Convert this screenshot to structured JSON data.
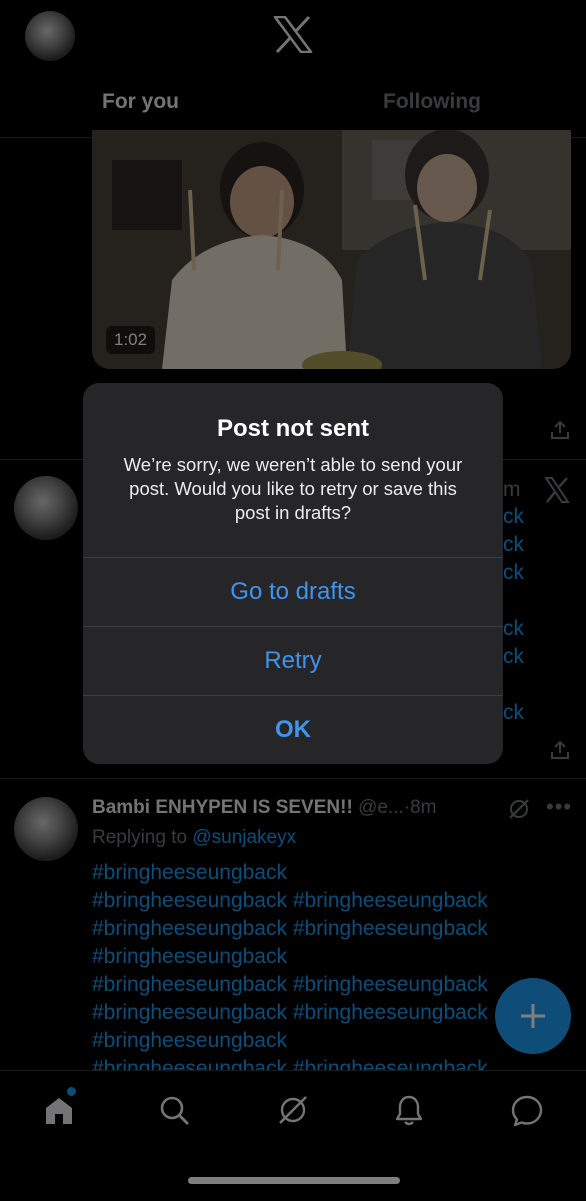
{
  "header": {
    "tabs": [
      {
        "label": "For you",
        "active": true
      },
      {
        "label": "Following",
        "active": false
      }
    ]
  },
  "feed": {
    "first_post": {
      "video_duration": "1:02"
    },
    "second_post": {
      "time_fragment": "m",
      "hashtag_fragments": [
        "ck",
        "ck",
        "ck",
        "ck",
        "ck",
        "ck"
      ]
    },
    "third_post": {
      "display_name": "Bambi ENHYPEN IS SEVEN!!",
      "handle": "@e...",
      "time": "·8m",
      "replying_prefix": "Replying to",
      "replying_handle": "@sunjakeyx",
      "hashtag_lines": [
        "#bringheeseungback",
        "#bringheeseungback #bringheeseungback",
        "#bringheeseungback #bringheeseungback",
        "#bringheeseungback",
        "#bringheeseungback #bringheeseungback",
        "#bringheeseungback #bringheeseungback",
        "#bringheeseungback",
        "#bringheeseungback #bringheeseungback"
      ]
    }
  },
  "alert": {
    "title": "Post not sent",
    "message": "We’re sorry, we weren’t able to send your post. Would you like to retry or save this post in drafts?",
    "buttons": [
      "Go to drafts",
      "Retry",
      "OK"
    ]
  },
  "colors": {
    "accent": "#1d9bf0",
    "alert_button": "#3d95f0",
    "background": "#000000"
  },
  "bottom_nav": {
    "icons": [
      "home-icon",
      "search-icon",
      "grok-icon",
      "notifications-icon",
      "messages-icon"
    ],
    "home_has_badge": true
  }
}
